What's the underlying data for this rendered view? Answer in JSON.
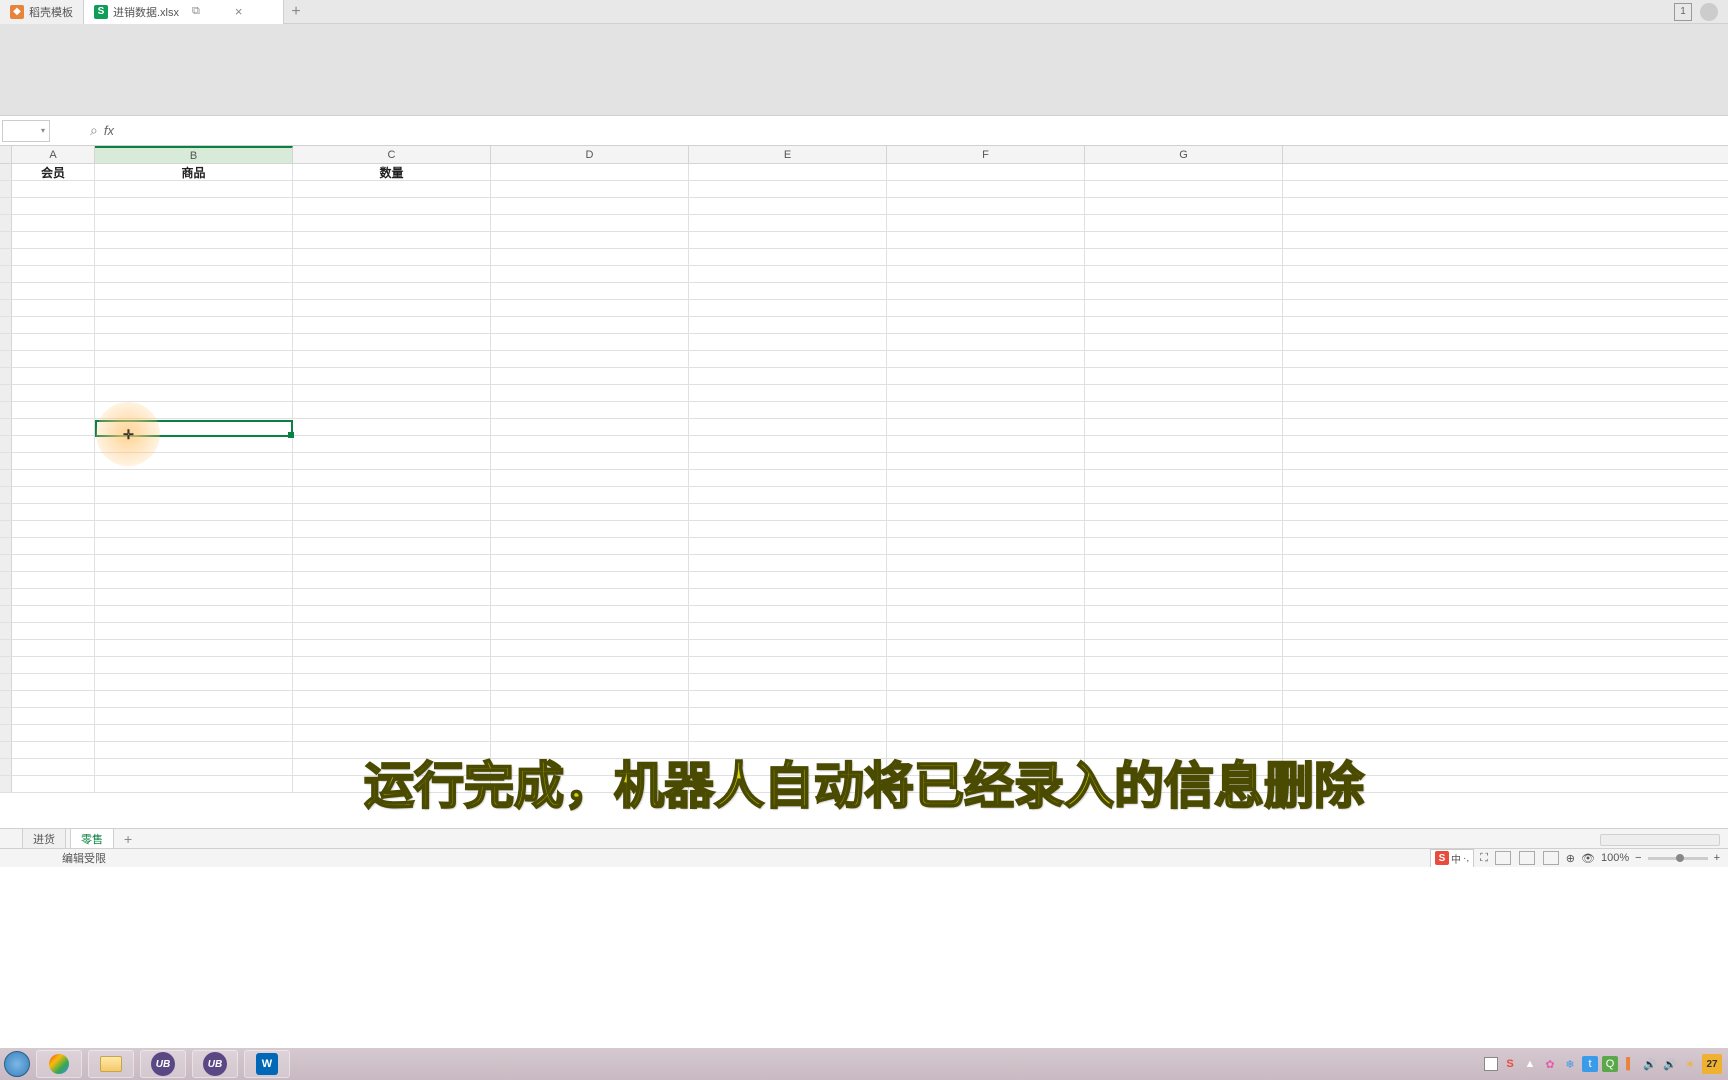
{
  "tabs": {
    "tab1_label": "稻壳模板",
    "tab2_label": "进销数据.xlsx",
    "tab2_window_icon": "⧉",
    "tab2_close": "×",
    "add": "+",
    "badge": "1"
  },
  "formula": {
    "name_box": "",
    "fx": "fx",
    "value": ""
  },
  "columns": {
    "a": "A",
    "b": "B",
    "c": "C",
    "d": "D",
    "e": "E",
    "f": "F",
    "g": "G"
  },
  "headers": {
    "a": "会员",
    "b": "商品",
    "c": "数量"
  },
  "cursor_plus": "✛",
  "subtitle": "运行完成，机器人自动将已经录入的信息删除",
  "sheets": {
    "s1": "进货",
    "s2": "零售",
    "add": "+"
  },
  "status": {
    "left": "编辑受限",
    "ime_s": "S",
    "ime_zh": "中",
    "zoom": "100%",
    "minus": "−",
    "plus": "+"
  },
  "taskbar": {
    "ub": "UB",
    "wps": "W",
    "date": "27"
  }
}
